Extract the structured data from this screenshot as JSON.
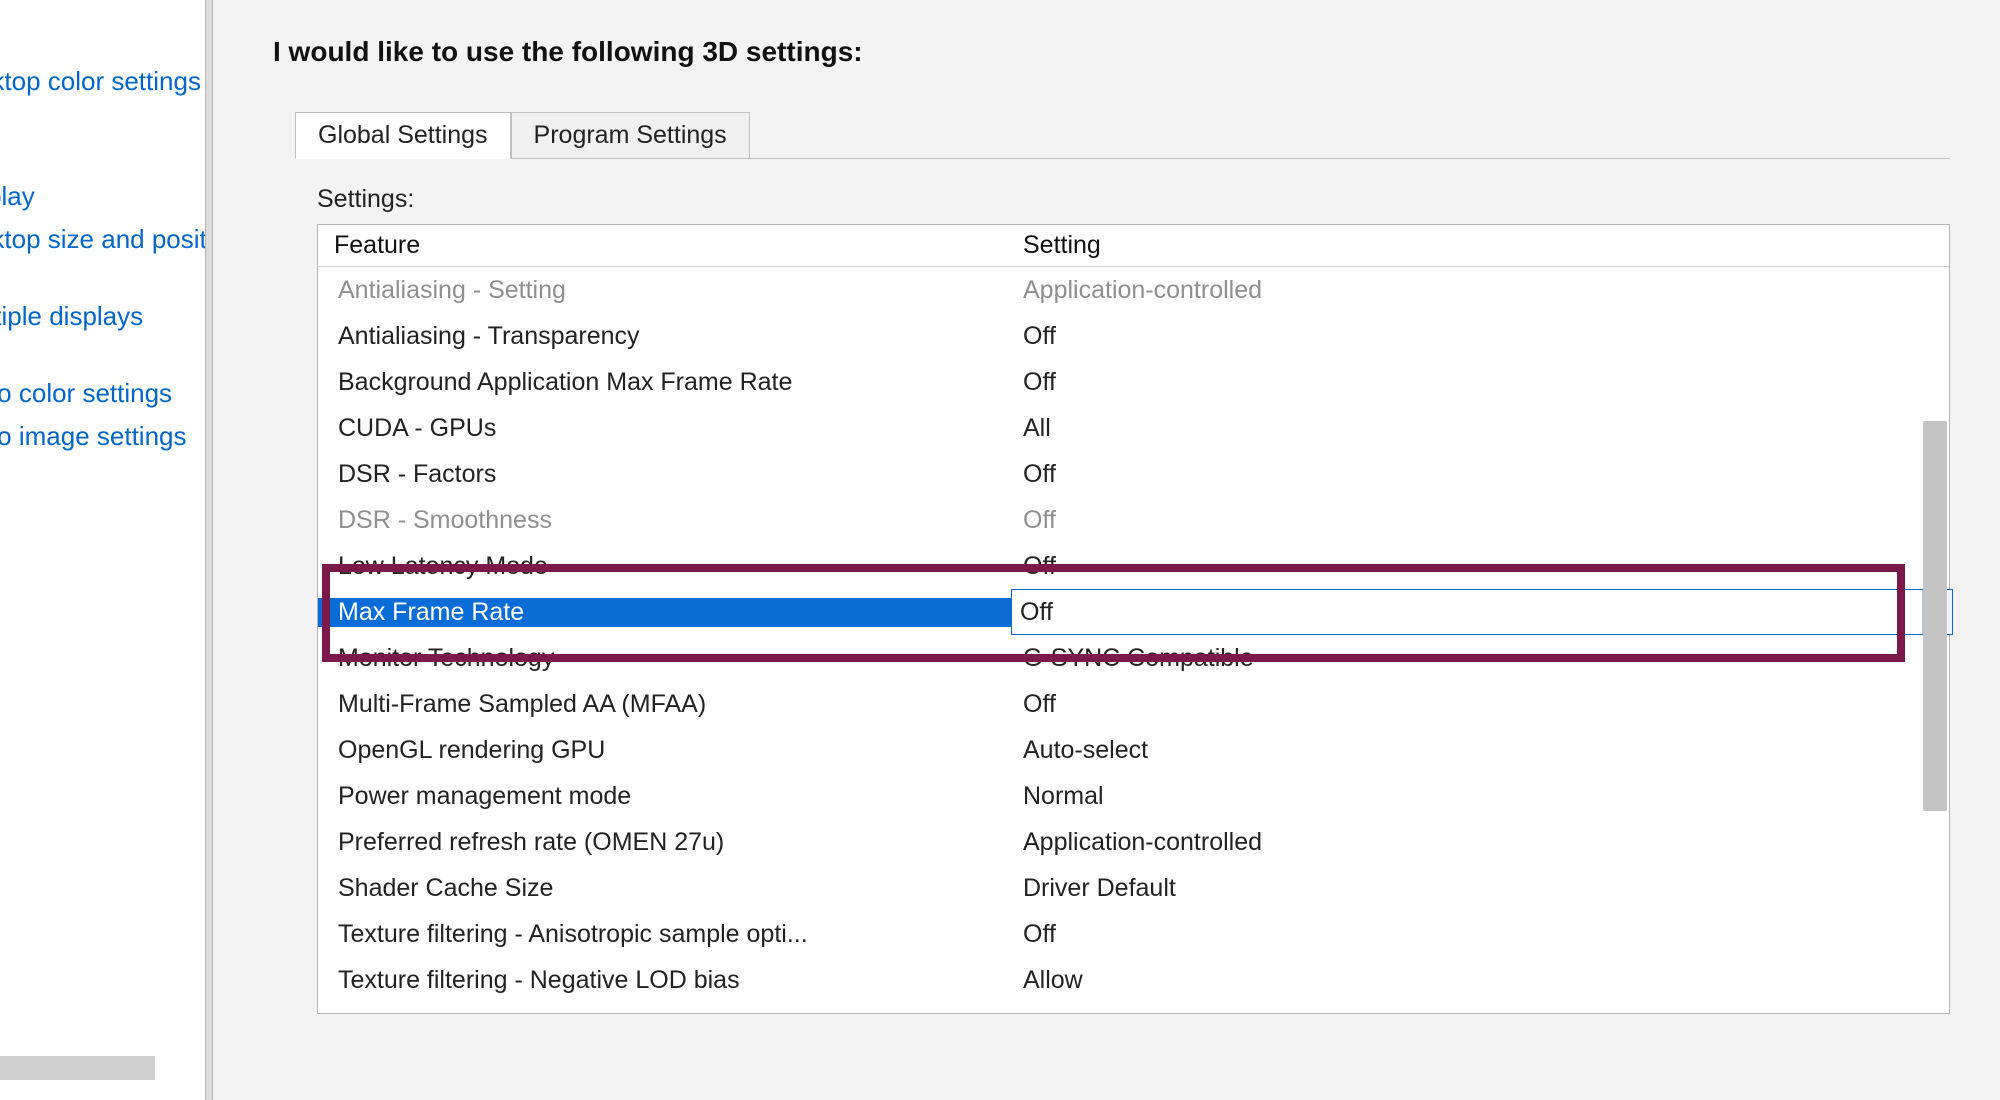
{
  "sidebar": {
    "links": [
      "Adjust desktop color settings",
      "Rotate display",
      "Adjust desktop size and position",
      "Set up multiple displays",
      "Adjust video color settings",
      "Adjust video image settings"
    ]
  },
  "main": {
    "heading": "I would like to use the following 3D settings:",
    "tabs": [
      {
        "label": "Global Settings",
        "active": true
      },
      {
        "label": "Program Settings",
        "active": false
      }
    ],
    "settings_label": "Settings:",
    "columns": {
      "feature": "Feature",
      "setting": "Setting"
    },
    "rows": [
      {
        "feature": "Antialiasing - Setting",
        "setting": "Application-controlled",
        "disabled": true
      },
      {
        "feature": "Antialiasing - Transparency",
        "setting": "Off"
      },
      {
        "feature": "Background Application Max Frame Rate",
        "setting": "Off"
      },
      {
        "feature": "CUDA - GPUs",
        "setting": "All"
      },
      {
        "feature": "DSR - Factors",
        "setting": "Off"
      },
      {
        "feature": "DSR - Smoothness",
        "setting": "Off",
        "disabled": true
      },
      {
        "feature": "Low Latency Mode",
        "setting": "Off"
      },
      {
        "feature": "Max Frame Rate",
        "setting": "Off",
        "selected": true
      },
      {
        "feature": "Monitor Technology",
        "setting": "G-SYNC Compatible"
      },
      {
        "feature": "Multi-Frame Sampled AA (MFAA)",
        "setting": "Off"
      },
      {
        "feature": "OpenGL rendering GPU",
        "setting": "Auto-select"
      },
      {
        "feature": "Power management mode",
        "setting": "Normal"
      },
      {
        "feature": "Preferred refresh rate (OMEN 27u)",
        "setting": "Application-controlled"
      },
      {
        "feature": "Shader Cache Size",
        "setting": "Driver Default"
      },
      {
        "feature": "Texture filtering - Anisotropic sample opti...",
        "setting": "Off"
      },
      {
        "feature": "Texture filtering - Negative LOD bias",
        "setting": "Allow"
      }
    ]
  },
  "annotation": {
    "highlighted_row_index": 7
  }
}
